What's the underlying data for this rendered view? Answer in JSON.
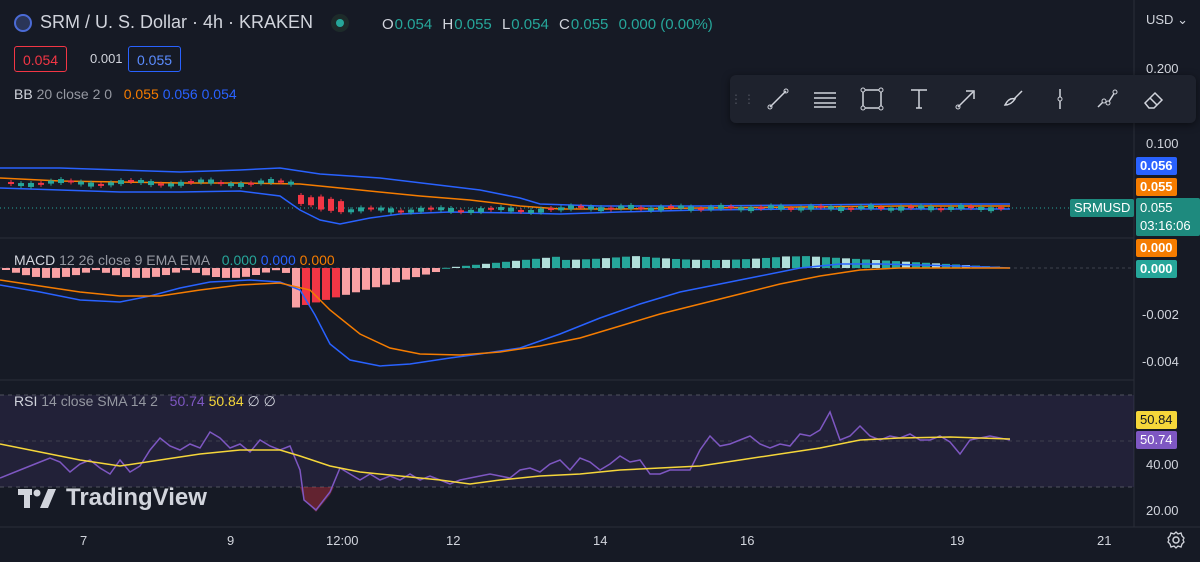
{
  "header": {
    "symbol_title": "SRM / U. S. Dollar · 4h · KRAKEN",
    "ohlc": [
      {
        "key": "O",
        "value": "0.054"
      },
      {
        "key": "H",
        "value": "0.055"
      },
      {
        "key": "L",
        "value": "0.054"
      },
      {
        "key": "C",
        "value": "0.055"
      }
    ],
    "change": "0.000 (0.00%)",
    "sell_price": "0.054",
    "spread": "0.001",
    "buy_price": "0.055"
  },
  "currency_menu": "USD",
  "indicators": {
    "bb": {
      "name": "BB",
      "params": "20 close 2 0",
      "v1": "0.055",
      "v2": "0.056",
      "v3": "0.054"
    },
    "macd": {
      "name": "MACD",
      "params": "12 26 close 9 EMA EMA",
      "v1": "0.000",
      "v2": "0.000",
      "v3": "0.000"
    },
    "rsi": {
      "name": "RSI",
      "params": "14 close SMA 14 2",
      "v1": "50.74",
      "v2": "50.84",
      "v3": "∅",
      "v4": "∅"
    }
  },
  "price_axis": {
    "labels": [
      "0.200",
      "0.100"
    ],
    "bb_upper_tag": "0.056",
    "bb_mid_tag": "0.055",
    "symbol_tag": "SRMUSD",
    "last_price_tag": "0.055",
    "countdown": "03:16:06"
  },
  "macd_axis": {
    "labels": [
      "-0.002",
      "-0.004"
    ],
    "tag1": "0.000",
    "tag2": "0.000"
  },
  "rsi_axis": {
    "labels": [
      "40.00",
      "20.00"
    ],
    "tag_sma": "50.84",
    "tag_rsi": "50.74"
  },
  "time_axis": [
    "7",
    "9",
    "12:00",
    "12",
    "14",
    "16",
    "19",
    "21"
  ],
  "logo_text": "TradingView",
  "toolbar": [
    "trend-line",
    "horizontal-lines",
    "rectangle",
    "text",
    "arrow",
    "brush",
    "vertical-line",
    "path",
    "eraser"
  ],
  "colors": {
    "background": "#161a25",
    "up": "#26a69a",
    "down": "#f23645",
    "bb_band": "#2962ff",
    "bb_basis": "#f57c00",
    "macd_line": "#2962ff",
    "signal_line": "#f57c00",
    "rsi_line": "#7e57c2",
    "rsi_sma": "#f5d63a"
  }
}
